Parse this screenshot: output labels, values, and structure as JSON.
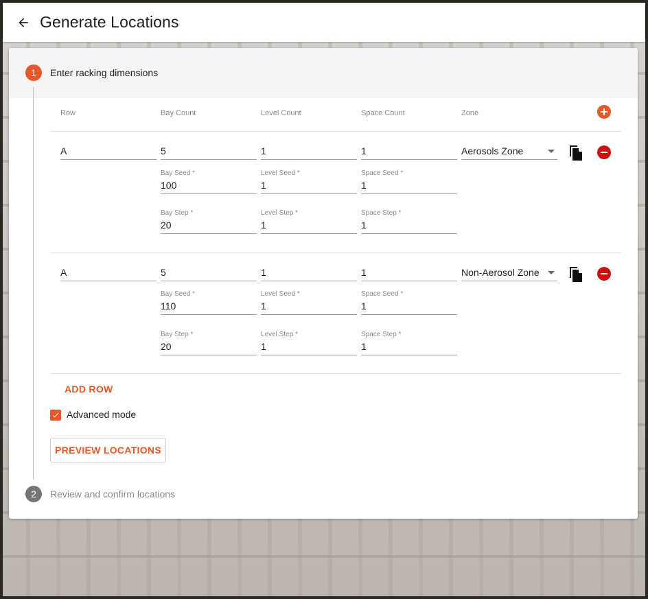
{
  "header": {
    "title": "Generate Locations"
  },
  "steps": [
    {
      "number": "1",
      "label": "Enter racking dimensions"
    },
    {
      "number": "2",
      "label": "Review and confirm locations"
    }
  ],
  "table": {
    "columns": [
      "Row",
      "Bay Count",
      "Level Count",
      "Space Count",
      "Zone"
    ],
    "rows": [
      {
        "row": "A",
        "bay_count": "5",
        "level_count": "1",
        "space_count": "1",
        "zone": "Aerosols Zone",
        "bay_seed_label": "Bay Seed *",
        "bay_seed": "100",
        "level_seed_label": "Level Seed *",
        "level_seed": "1",
        "space_seed_label": "Space Seed *",
        "space_seed": "1",
        "bay_step_label": "Bay Step *",
        "bay_step": "20",
        "level_step_label": "Level Step *",
        "level_step": "1",
        "space_step_label": "Space Step *",
        "space_step": "1"
      },
      {
        "row": "A",
        "bay_count": "5",
        "level_count": "1",
        "space_count": "1",
        "zone": "Non-Aerosol Zone",
        "bay_seed_label": "Bay Seed *",
        "bay_seed": "110",
        "level_seed_label": "Level Seed *",
        "level_seed": "1",
        "space_seed_label": "Space Seed *",
        "space_seed": "1",
        "bay_step_label": "Bay Step *",
        "bay_step": "20",
        "level_step_label": "Level Step *",
        "level_step": "1",
        "space_step_label": "Space Step *",
        "space_step": "1"
      }
    ]
  },
  "actions": {
    "add_row": "ADD ROW",
    "advanced_mode": "Advanced mode",
    "advanced_mode_checked": true,
    "preview": "PREVIEW LOCATIONS"
  },
  "colors": {
    "accent": "#e8572a",
    "remove": "#cc1111",
    "step_inactive": "#757575"
  },
  "icons": {
    "back": "arrow-back-icon",
    "add": "add-circle-icon",
    "copy": "copy-icon",
    "remove": "remove-circle-icon",
    "check": "check-icon",
    "dropdown": "chevron-down-icon"
  }
}
